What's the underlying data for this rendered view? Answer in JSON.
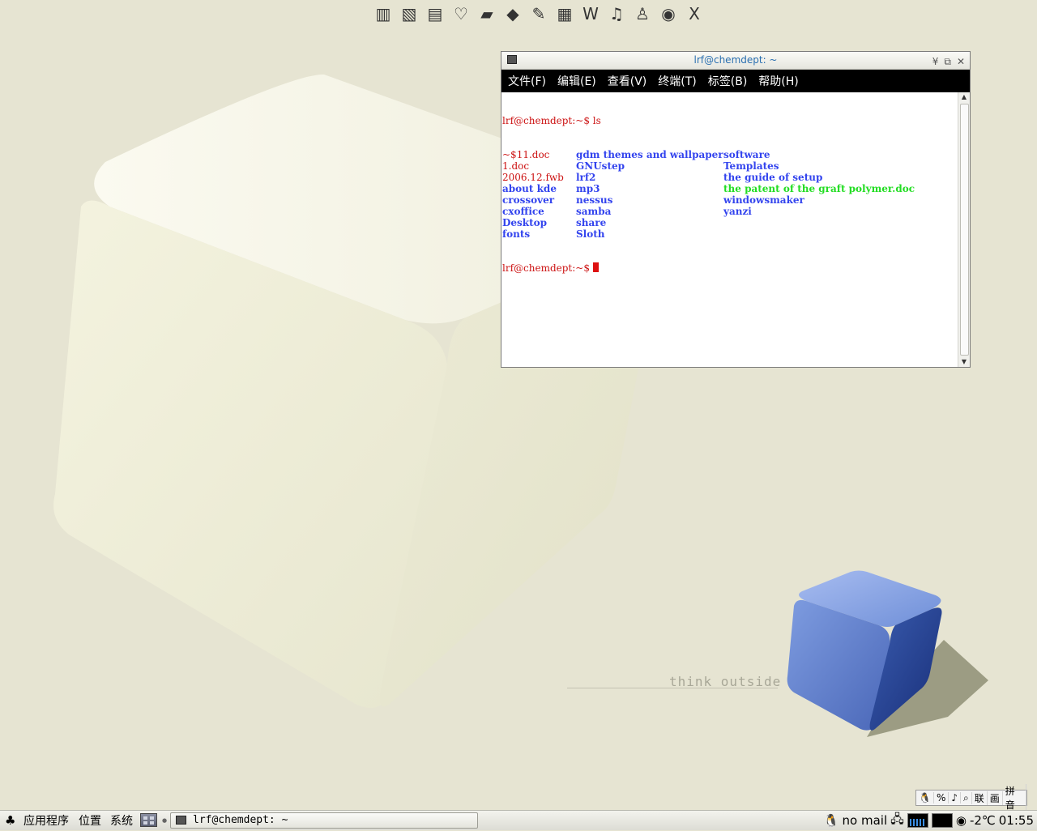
{
  "launcher": {
    "items": [
      {
        "name": "file-manager-icon",
        "glyph": "▥"
      },
      {
        "name": "documents-icon",
        "glyph": "▧"
      },
      {
        "name": "scroll-icon",
        "glyph": "▤"
      },
      {
        "name": "photo-album-icon",
        "glyph": "♡"
      },
      {
        "name": "books-icon",
        "glyph": "▰"
      },
      {
        "name": "education-icon",
        "glyph": "◆"
      },
      {
        "name": "gimp-icon",
        "glyph": "✎"
      },
      {
        "name": "film-icon",
        "glyph": "▦"
      },
      {
        "name": "word-processor-icon",
        "glyph": "W"
      },
      {
        "name": "music-icon",
        "glyph": "♫"
      },
      {
        "name": "messenger-icon",
        "glyph": "♙"
      },
      {
        "name": "term-icon",
        "glyph": "◉"
      },
      {
        "name": "x-close-icon",
        "glyph": "X"
      }
    ]
  },
  "wallpaper": {
    "caption": "think outside"
  },
  "terminal": {
    "title": "lrf@chemdept: ~",
    "menu": [
      "文件(F)",
      "编辑(E)",
      "查看(V)",
      "终端(T)",
      "标签(B)",
      "帮助(H)"
    ],
    "prompt_line": "lrf@chemdept:~$ ls",
    "rows": [
      [
        {
          "t": "~$11.doc",
          "c": "red"
        },
        {
          "t": "gdm themes and wallpaper",
          "c": "blue"
        },
        {
          "t": "software",
          "c": "blue"
        }
      ],
      [
        {
          "t": "1.doc",
          "c": "red"
        },
        {
          "t": "GNUstep",
          "c": "blue"
        },
        {
          "t": "Templates",
          "c": "blue"
        }
      ],
      [
        {
          "t": "2006.12.fwb",
          "c": "red"
        },
        {
          "t": "lrf2",
          "c": "blue"
        },
        {
          "t": "the guide of setup",
          "c": "blue"
        }
      ],
      [
        {
          "t": "about kde",
          "c": "blue"
        },
        {
          "t": "mp3",
          "c": "blue"
        },
        {
          "t": "the patent of the graft polymer.doc",
          "c": "green"
        }
      ],
      [
        {
          "t": "crossover",
          "c": "blue"
        },
        {
          "t": "nessus",
          "c": "blue"
        },
        {
          "t": "windowsmaker",
          "c": "blue"
        }
      ],
      [
        {
          "t": "cxoffice",
          "c": "blue"
        },
        {
          "t": "samba",
          "c": "blue"
        },
        {
          "t": "yanzi",
          "c": "blue"
        }
      ],
      [
        {
          "t": "Desktop",
          "c": "blue"
        },
        {
          "t": "share",
          "c": "blue"
        },
        {
          "t": "",
          "c": "blue"
        }
      ],
      [
        {
          "t": "fonts",
          "c": "blue"
        },
        {
          "t": "Sloth",
          "c": "blue"
        },
        {
          "t": "",
          "c": "blue"
        }
      ]
    ],
    "final_prompt": "lrf@chemdept:~$ "
  },
  "ime": [
    "🐧",
    "%",
    "♪",
    "⌕",
    "联",
    "画",
    "拼音"
  ],
  "panel": {
    "menus": [
      "应用程序",
      "位置",
      "系统"
    ],
    "task_title": "lrf@chemdept: ~",
    "mail": "no mail",
    "weather": "-2℃",
    "clock": "01:55"
  },
  "colors": {
    "background": "#e6e4d2",
    "prompt_red": "#cc1111",
    "dir_blue": "#3344ee",
    "exec_green": "#22dd22",
    "cube_blue": "#6f8fd8"
  }
}
